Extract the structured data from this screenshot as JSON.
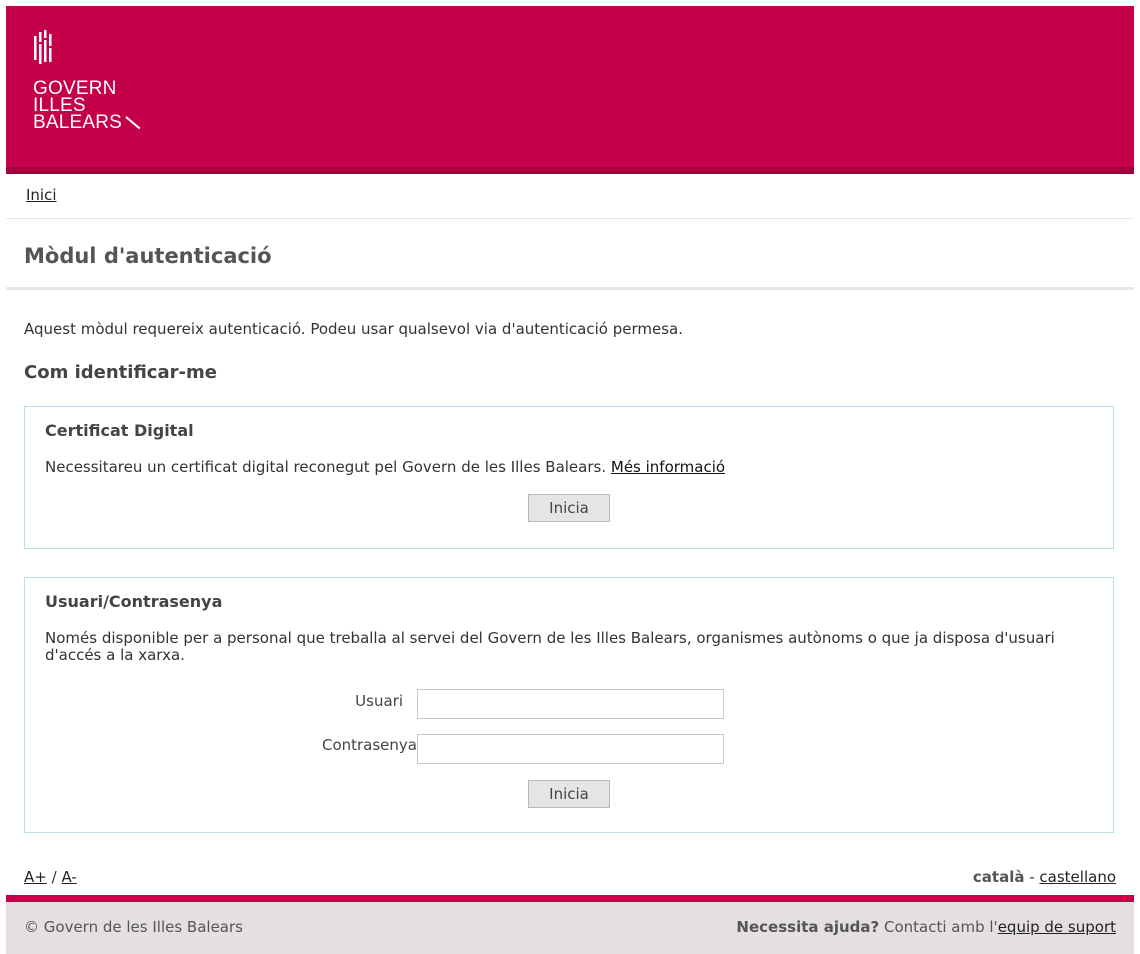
{
  "header": {
    "logo_lines": [
      "GOVERN",
      "ILLES",
      "BALEARS"
    ],
    "brand_color": "#c4004b"
  },
  "breadcrumb": {
    "home_label": "Inici"
  },
  "page": {
    "title": "Mòdul d'autenticació",
    "intro": "Aquest mòdul requereix autenticació. Podeu usar qualsevol via d'autenticació permesa.",
    "section_heading": "Com identificar-me"
  },
  "certificate_box": {
    "title": "Certificat Digital",
    "description": "Necessitareu un certificat digital reconegut pel Govern de les Illes Balears.",
    "more_info_link": "Més informació",
    "button_label": "Inicia"
  },
  "login_box": {
    "title": "Usuari/Contrasenya",
    "description": "Només disponible per a personal que treballa al servei del Govern de les Illes Balears, organismes autònoms o que ja disposa d'usuari d'accés a la xarxa.",
    "user_label": "Usuari",
    "user_value": "",
    "password_label": "Contrasenya",
    "password_value": "",
    "button_label": "Inicia"
  },
  "font_size": {
    "increase": "A+",
    "separator": " / ",
    "decrease": "A-"
  },
  "languages": {
    "current": "català",
    "separator": " - ",
    "other": "castellano"
  },
  "footer": {
    "copyright": "© Govern de les Illes Balears",
    "help_question": "Necessita ajuda?",
    "help_text": " Contacti amb l'",
    "support_link": "equip de suport"
  }
}
